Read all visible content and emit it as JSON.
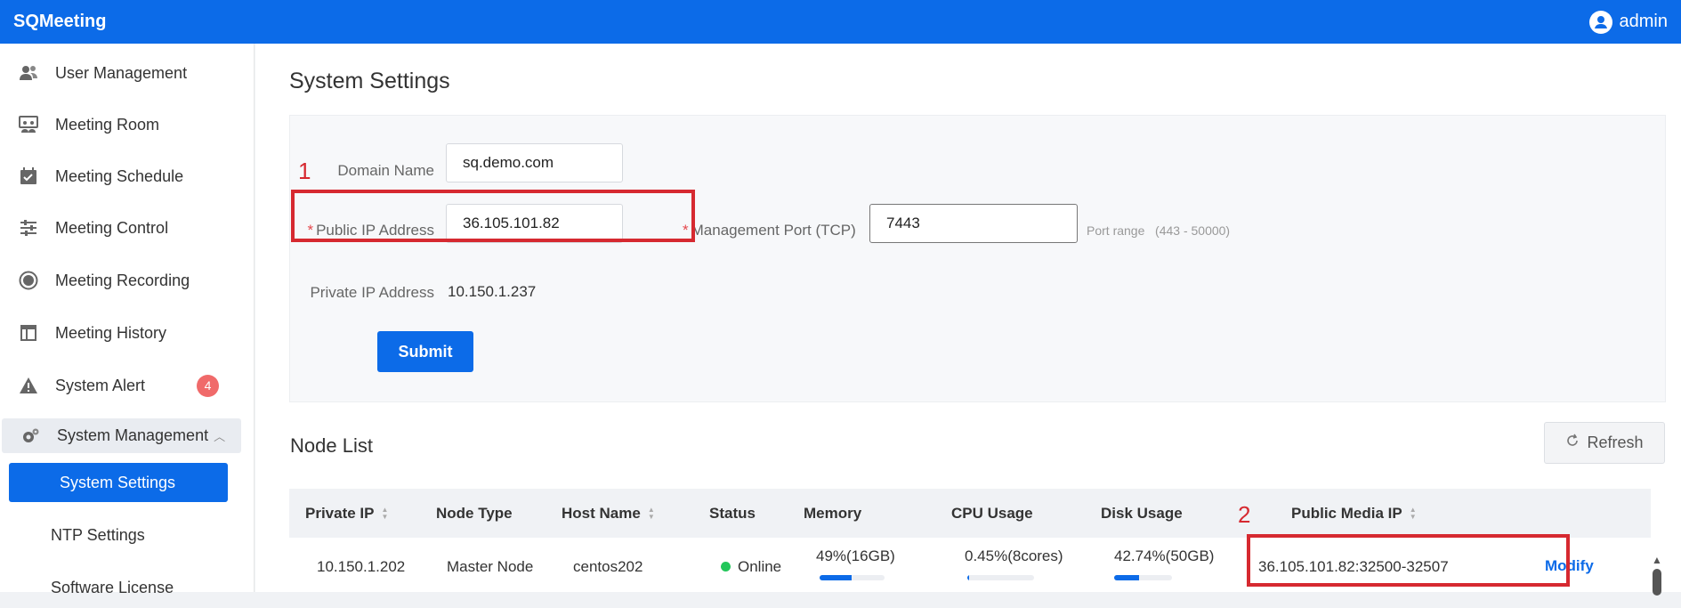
{
  "app": {
    "title": "SQMeeting",
    "user": "admin"
  },
  "sidebar": {
    "items": [
      {
        "label": "User Management",
        "icon": "users-icon"
      },
      {
        "label": "Meeting Room",
        "icon": "meeting-room-icon"
      },
      {
        "label": "Meeting Schedule",
        "icon": "calendar-check-icon"
      },
      {
        "label": "Meeting Control",
        "icon": "sliders-icon"
      },
      {
        "label": "Meeting Recording",
        "icon": "record-icon"
      },
      {
        "label": "Meeting History",
        "icon": "history-table-icon"
      },
      {
        "label": "System Alert",
        "icon": "warning-icon",
        "badge": "4"
      },
      {
        "label": "System Management",
        "icon": "gears-icon"
      },
      {
        "label": "System Settings"
      },
      {
        "label": "NTP Settings"
      },
      {
        "label": "Software License"
      }
    ]
  },
  "page": {
    "title": "System Settings"
  },
  "form": {
    "domain_label": "Domain Name",
    "domain_value": "sq.demo.com",
    "public_ip_label": "Public IP Address",
    "public_ip_value": "36.105.101.82",
    "mgmt_port_label": "Management Port (TCP)",
    "mgmt_port_value": "7443",
    "port_range_hint": "Port range   (443 - 50000)",
    "private_ip_label": "Private IP Address",
    "private_ip_value": "10.150.1.237",
    "submit_label": "Submit",
    "required_mark": "*"
  },
  "annotations": {
    "mark1": "1",
    "mark2": "2"
  },
  "nodes": {
    "title": "Node List",
    "refresh_label": "Refresh",
    "columns": [
      "Private IP",
      "Node Type",
      "Host Name",
      "Status",
      "Memory",
      "CPU Usage",
      "Disk Usage",
      "Public Media IP"
    ],
    "rows": [
      {
        "private_ip": "10.150.1.202",
        "node_type": "Master Node",
        "host_name": "centos202",
        "status": "Online",
        "memory": "49%(16GB)",
        "memory_pct": 49,
        "cpu": "0.45%(8cores)",
        "cpu_pct": 0.45,
        "disk": "42.74%(50GB)",
        "disk_pct": 42.74,
        "public_media_ip": "36.105.101.82:32500-32507",
        "action": "Modify"
      }
    ]
  },
  "colors": {
    "primary": "#0c6be8",
    "highlight": "#d62930",
    "online": "#23c65a",
    "badge": "#f06a6a"
  }
}
